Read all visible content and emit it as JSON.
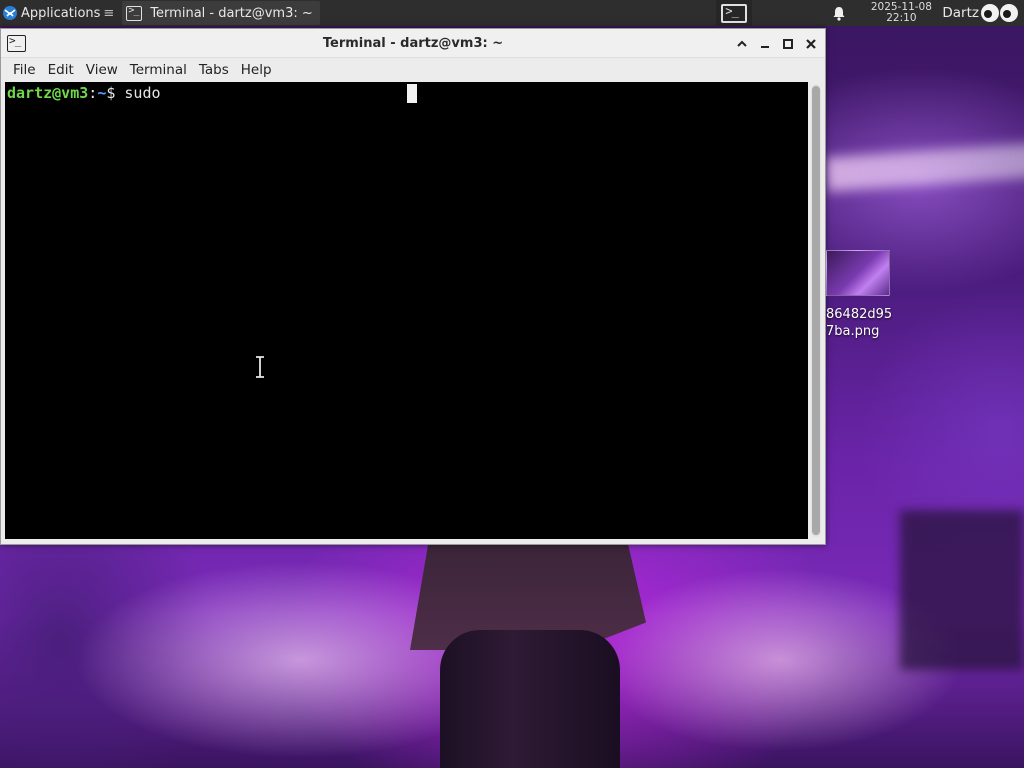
{
  "top_panel": {
    "apps_label": "Applications",
    "apps_separator": "≡",
    "task_label": "Terminal - dartz@vm3: ~",
    "clock_date": "2025-11-08",
    "clock_time": "22:10",
    "user_name": "Dartz"
  },
  "window": {
    "title": "Terminal - dartz@vm3: ~",
    "menu": [
      "File",
      "Edit",
      "View",
      "Terminal",
      "Tabs",
      "Help"
    ]
  },
  "terminal": {
    "prompt_user_host": "dartz@vm3",
    "prompt_sep": ":",
    "prompt_path": "~",
    "prompt_symbol": "$ ",
    "command": "sudo"
  },
  "desktop_icon": {
    "label_line1": "86482d95",
    "label_line2": "7ba.png"
  },
  "colors": {
    "prompt_user": "#6ed84a",
    "prompt_path": "#5aa0ff",
    "terminal_bg": "#000000",
    "panel_bg": "#2e2e2e"
  },
  "icons": [
    "xfce-logo-icon",
    "terminal-icon",
    "bell-icon",
    "eyes-icon",
    "minimize-icon",
    "maximize-icon",
    "close-icon",
    "shade-icon",
    "ibeam-cursor-icon"
  ]
}
